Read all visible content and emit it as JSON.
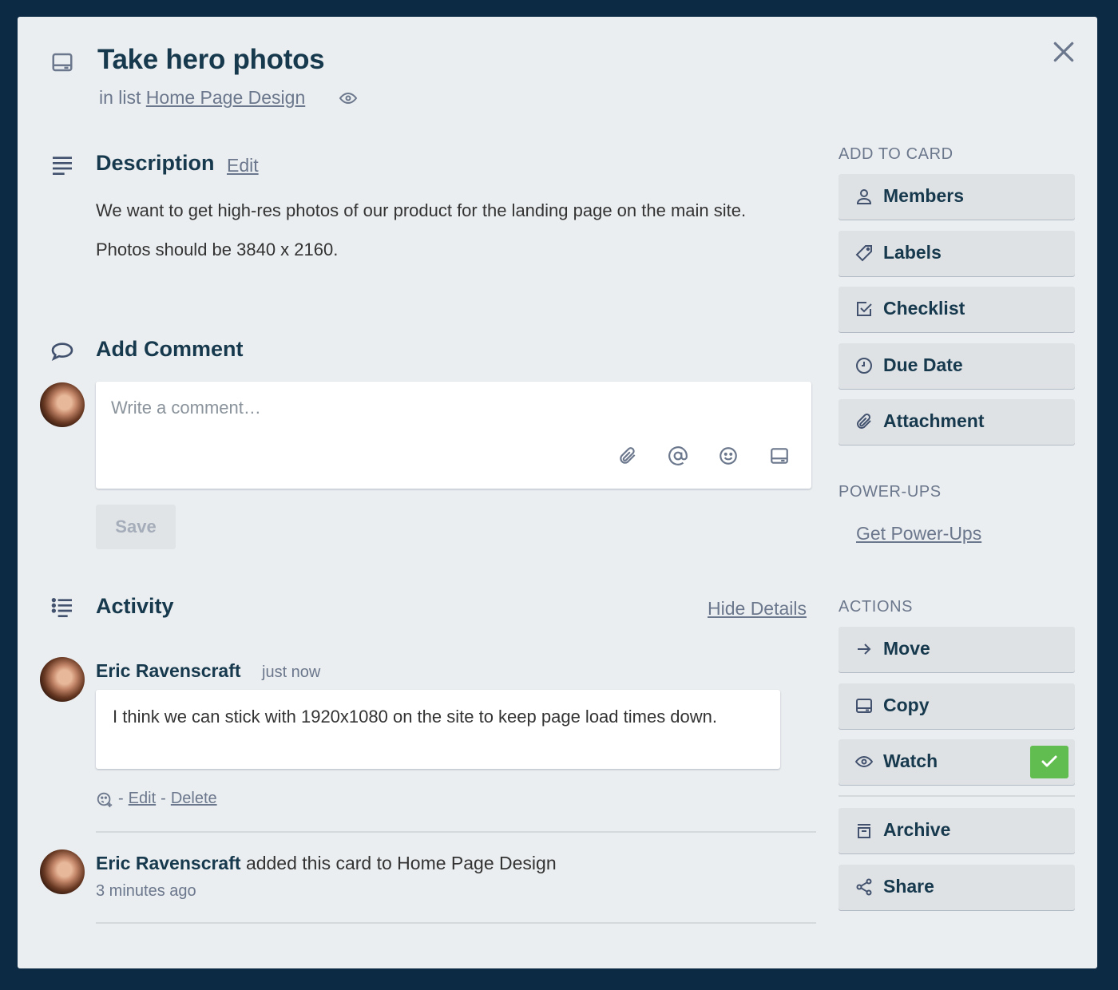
{
  "card": {
    "title": "Take hero photos",
    "list_prefix": "in list",
    "list_name": "Home Page Design"
  },
  "description": {
    "title": "Description",
    "edit_label": "Edit",
    "paragraph_1": "We want to get high-res photos of our product for the landing page on the main site.",
    "paragraph_2": "Photos should be 3840 x 2160."
  },
  "add_comment": {
    "title": "Add Comment",
    "placeholder": "Write a comment…",
    "save_label": "Save"
  },
  "activity": {
    "title": "Activity",
    "hide_details_label": "Hide Details",
    "comment": {
      "author": "Eric Ravenscraft",
      "time": "just now",
      "text": "I think we can stick with 1920x1080 on the site to keep page load times down.",
      "dash": "-",
      "edit_label": "Edit",
      "delete_label": "Delete"
    },
    "event": {
      "author": "Eric Ravenscraft",
      "action": "added this card to Home Page Design",
      "time": "3 minutes ago"
    }
  },
  "sidebar": {
    "add_to_card_heading": "ADD TO CARD",
    "add_to_card": [
      {
        "label": "Members",
        "icon": "person-icon"
      },
      {
        "label": "Labels",
        "icon": "tag-icon"
      },
      {
        "label": "Checklist",
        "icon": "checkbox-icon"
      },
      {
        "label": "Due Date",
        "icon": "clock-icon"
      },
      {
        "label": "Attachment",
        "icon": "paperclip-icon"
      }
    ],
    "power_ups_heading": "POWER-UPS",
    "get_power_ups_label": "Get Power-Ups",
    "actions_heading": "ACTIONS",
    "actions": [
      {
        "label": "Move",
        "icon": "arrow-right-icon"
      },
      {
        "label": "Copy",
        "icon": "card-icon"
      },
      {
        "label": "Watch",
        "icon": "eye-icon",
        "checked": true
      },
      {
        "label": "Archive",
        "icon": "archive-icon"
      },
      {
        "label": "Share",
        "icon": "share-icon"
      }
    ]
  },
  "colors": {
    "backdrop": "#0d2a44",
    "modal": "#ebeef0",
    "watch_check": "#61bd4f"
  }
}
